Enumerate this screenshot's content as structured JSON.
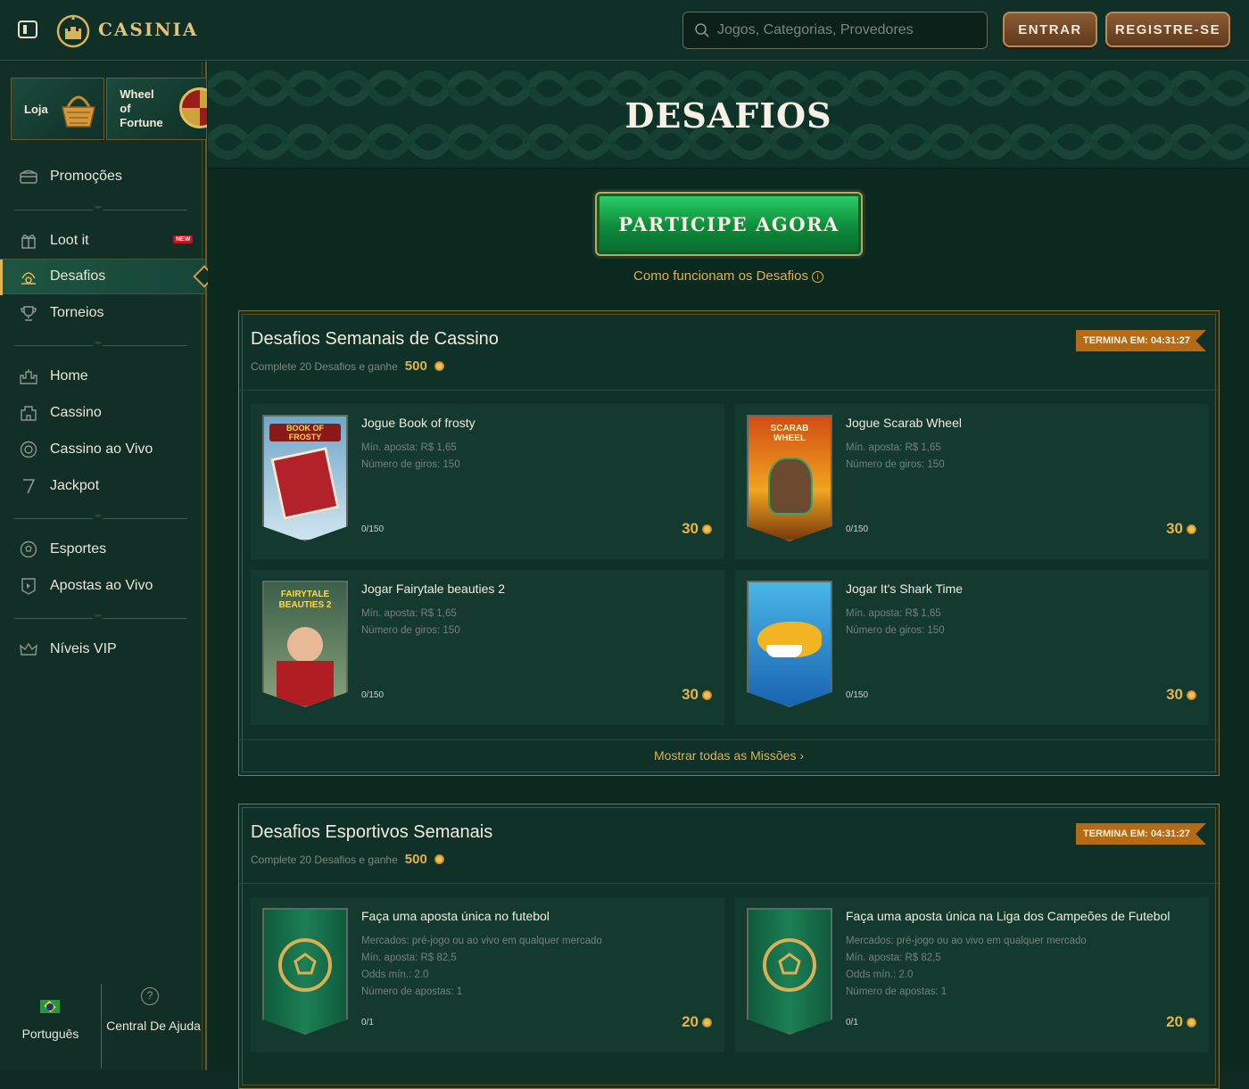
{
  "header": {
    "brand": "CASINIA",
    "search_placeholder": "Jogos, Categorias, Provedores",
    "login_label": "ENTRAR",
    "register_label": "REGISTRE-SE"
  },
  "sidebar": {
    "promo_loja": "Loja",
    "promo_wheel": [
      "Wheel",
      "of",
      "Fortune"
    ],
    "items": [
      {
        "label": "Promoções",
        "icon": "chest-icon"
      },
      {
        "label": "Loot it",
        "icon": "gift-icon",
        "badge": "NEW"
      },
      {
        "label": "Desafios",
        "icon": "challenge-icon",
        "active": true
      },
      {
        "label": "Torneios",
        "icon": "trophy-icon"
      },
      {
        "label": "Home",
        "icon": "castle-icon"
      },
      {
        "label": "Cassino",
        "icon": "casino-icon"
      },
      {
        "label": "Cassino ao Vivo",
        "icon": "chip-icon"
      },
      {
        "label": "Jackpot",
        "icon": "seven-icon"
      },
      {
        "label": "Esportes",
        "icon": "soccer-ball-icon"
      },
      {
        "label": "Apostas ao Vivo",
        "icon": "live-bet-icon"
      },
      {
        "label": "Níveis VIP",
        "icon": "crown-icon"
      }
    ],
    "language": "Português",
    "help": "Central De Ajuda"
  },
  "main": {
    "title": "DESAFIOS",
    "cta_label": "PARTICIPE AGORA",
    "how_link": "Como funcionam os Desafios",
    "panels": [
      {
        "title": "Desafios Semanais de Cassino",
        "subtitle": "Complete 20 Desafios e ganhe",
        "reward": "500",
        "timer": "TERMINA EM: 04:31:27",
        "show_all": "Mostrar todas as Missões",
        "cards": [
          {
            "title": "Jogue Book of frosty",
            "meta": [
              "Mín. aposta: R$ 1,65",
              "Número de giros: 150"
            ],
            "progress": "0/150",
            "reward": "30"
          },
          {
            "title": "Jogue Scarab Wheel",
            "meta": [
              "Mín. aposta: R$ 1,65",
              "Número de giros: 150"
            ],
            "progress": "0/150",
            "reward": "30"
          },
          {
            "title": "Jogar Fairytale beauties 2",
            "meta": [
              "Mín. aposta: R$ 1,65",
              "Número de giros: 150"
            ],
            "progress": "0/150",
            "reward": "30"
          },
          {
            "title": "Jogar It's Shark Time",
            "meta": [
              "Mín. aposta: R$ 1,65",
              "Número de giros: 150"
            ],
            "progress": "0/150",
            "reward": "30"
          }
        ]
      },
      {
        "title": "Desafios Esportivos Semanais",
        "subtitle": "Complete 20 Desafios e ganhe",
        "reward": "500",
        "timer": "TERMINA EM: 04:31:27",
        "cards": [
          {
            "title": "Faça uma aposta única no futebol",
            "meta": [
              "Mercados: pré-jogo ou ao vivo em qualquer mercado",
              "Mín. aposta: R$ 82,5",
              "Odds mín.: 2.0",
              "Número de apostas: 1"
            ],
            "progress": "0/1",
            "reward": "20"
          },
          {
            "title": "Faça uma aposta única na Liga dos Campeões de Futebol",
            "meta": [
              "Mercados: pré-jogo ou ao vivo em qualquer mercado",
              "Mín. aposta: R$ 82,5",
              "Odds mín.: 2.0",
              "Número de apostas: 1"
            ],
            "progress": "0/1",
            "reward": "20"
          }
        ]
      }
    ],
    "thumb_labels": [
      "BOOK OF FROSTY",
      "SCARAB WHEEL",
      "FAIRYTALE BEAUTIES 2"
    ]
  },
  "colors": {
    "accent_gold": "#dbb257",
    "bg_green": "#0c2920",
    "cta_green": "#0e8a3b",
    "timer_orange": "#b46a17",
    "brown_button": "#7a4d2b"
  }
}
